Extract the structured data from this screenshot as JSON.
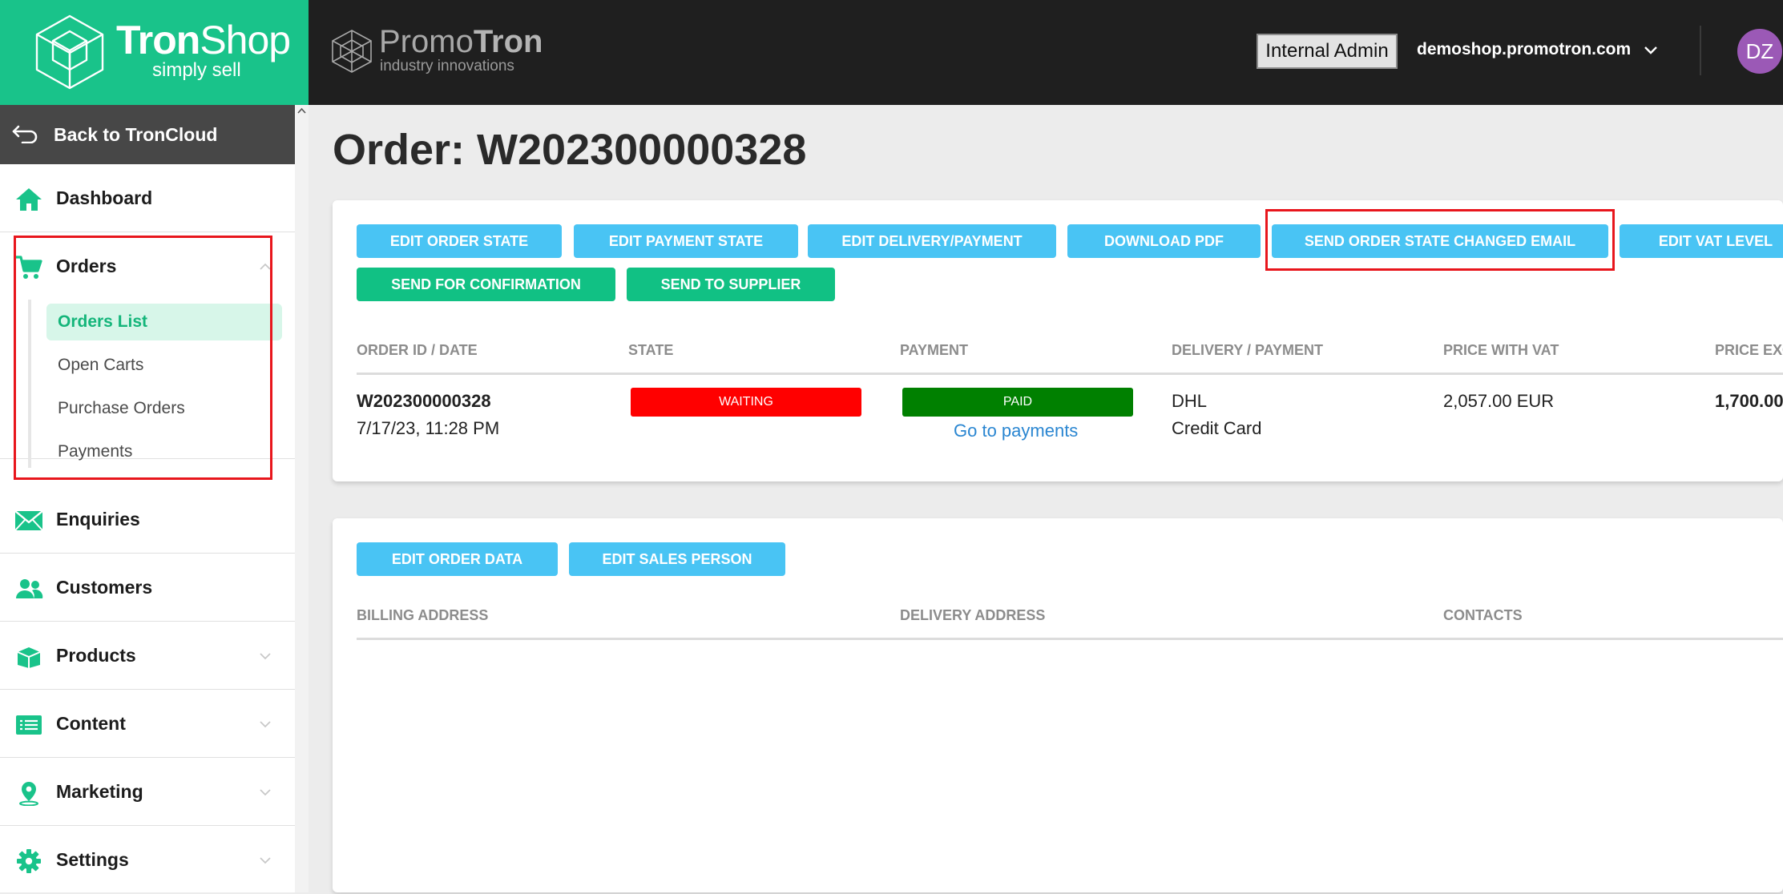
{
  "brand": {
    "name_bold": "Tron",
    "name_light": "Shop",
    "tagline": "simply sell",
    "color": "#19c38a"
  },
  "partner": {
    "name_light": "Promo",
    "name_bold": "Tron",
    "tagline": "industry innovations"
  },
  "header": {
    "role": "Internal Admin",
    "shop_domain": "demoshop.promotron.com",
    "avatar_initials": "DZ",
    "avatar_color": "#9b59b6"
  },
  "sidebar": {
    "back_label": "Back to TronCloud",
    "items": [
      {
        "label": "Dashboard",
        "icon": "home-icon"
      },
      {
        "label": "Orders",
        "icon": "cart-icon",
        "expanded": true,
        "children": [
          {
            "label": "Orders List",
            "active": true
          },
          {
            "label": "Open Carts"
          },
          {
            "label": "Purchase Orders"
          },
          {
            "label": "Payments"
          }
        ]
      },
      {
        "label": "Enquiries",
        "icon": "envelope-icon"
      },
      {
        "label": "Customers",
        "icon": "users-icon"
      },
      {
        "label": "Products",
        "icon": "box-icon"
      },
      {
        "label": "Content",
        "icon": "list-icon"
      },
      {
        "label": "Marketing",
        "icon": "map-pin-icon"
      },
      {
        "label": "Settings",
        "icon": "gear-icon"
      }
    ]
  },
  "page": {
    "title": "Order: W202300000328"
  },
  "order_card": {
    "buttons": [
      "EDIT ORDER STATE",
      "EDIT PAYMENT STATE",
      "EDIT DELIVERY/PAYMENT",
      "DOWNLOAD PDF",
      "SEND ORDER STATE CHANGED EMAIL",
      "EDIT VAT LEVEL",
      "SEND FOR CONFIRMATION",
      "SEND TO SUPPLIER"
    ],
    "columns": [
      "ORDER ID / DATE",
      "STATE",
      "PAYMENT",
      "DELIVERY / PAYMENT",
      "PRICE WITH VAT",
      "PRICE EXC"
    ],
    "row": {
      "order_id": "W202300000328",
      "date": "7/17/23, 11:28 PM",
      "state": "WAITING",
      "state_color": "#ff0000",
      "payment": "PAID",
      "payment_color": "#008000",
      "payment_link": "Go to payments",
      "delivery": "DHL",
      "payment_method": "Credit Card",
      "price_with_vat": "2,057.00 EUR",
      "price_exc": "1,700.00"
    }
  },
  "address_card": {
    "buttons": [
      "EDIT ORDER DATA",
      "EDIT SALES PERSON"
    ],
    "columns": [
      "BILLING ADDRESS",
      "DELIVERY ADDRESS",
      "CONTACTS"
    ]
  },
  "colors": {
    "button_blue": "#49c4f4",
    "button_green": "#11c184",
    "highlight_red": "#e8161c"
  }
}
